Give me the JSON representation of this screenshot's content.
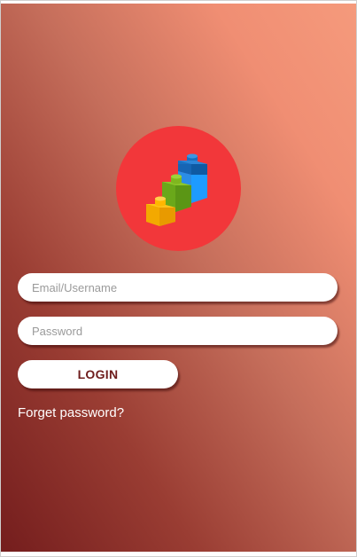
{
  "login_form": {
    "email_placeholder": "Email/Username",
    "email_value": "",
    "password_placeholder": "Password",
    "password_value": "",
    "login_label": "LOGIN",
    "forget_password_label": "Forget password?"
  },
  "logo": {
    "icon": "building-blocks-stairs-icon",
    "circle_color": "#f2373a",
    "block_colors": [
      "#ffb700",
      "#7fb71f",
      "#1e9bff",
      "#1a6fc0"
    ]
  },
  "theme": {
    "gradient_dark": "#741d1d",
    "gradient_light": "#f59a7c",
    "button_text_color": "#6e1c1c"
  }
}
